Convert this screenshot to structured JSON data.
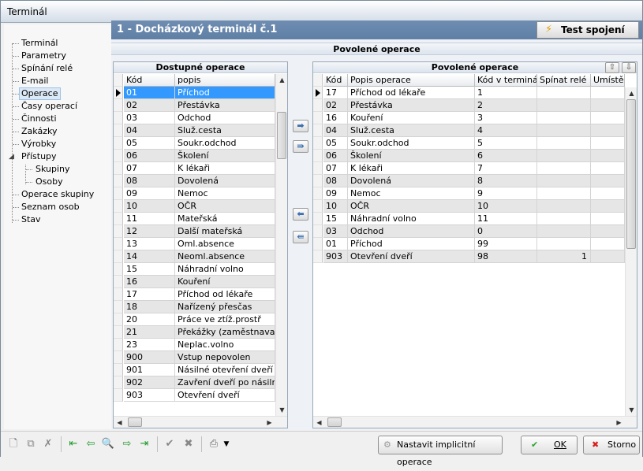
{
  "window": {
    "title": "Terminál"
  },
  "tree": {
    "items": [
      {
        "label": "Terminál",
        "level": 0
      },
      {
        "label": "Parametry",
        "level": 0
      },
      {
        "label": "Spínání relé",
        "level": 0
      },
      {
        "label": "E-mail",
        "level": 0
      },
      {
        "label": "Operace",
        "level": 0,
        "selected": true
      },
      {
        "label": "Časy operací",
        "level": 0
      },
      {
        "label": "Činnosti",
        "level": 0
      },
      {
        "label": "Zakázky",
        "level": 0
      },
      {
        "label": "Výrobky",
        "level": 0
      },
      {
        "label": "Přístupy",
        "level": 0,
        "expanded": true
      },
      {
        "label": "Skupiny",
        "level": 1
      },
      {
        "label": "Osoby",
        "level": 1
      },
      {
        "label": "Operace skupiny",
        "level": 0
      },
      {
        "label": "Seznam osob",
        "level": 0
      },
      {
        "label": "Stav",
        "level": 0
      }
    ]
  },
  "header": {
    "title": "1  -  Docházkový terminál č.1",
    "test_button": "Test spojení",
    "section_title": "Povolené operace"
  },
  "available": {
    "caption": "Dostupné operace",
    "columns": [
      "Kód",
      "popis"
    ],
    "rows": [
      [
        "01",
        "Příchod"
      ],
      [
        "02",
        "Přestávka"
      ],
      [
        "03",
        "Odchod"
      ],
      [
        "04",
        "Služ.cesta"
      ],
      [
        "05",
        "Soukr.odchod"
      ],
      [
        "06",
        "Školení"
      ],
      [
        "07",
        "K lékaři"
      ],
      [
        "08",
        "Dovolená"
      ],
      [
        "09",
        "Nemoc"
      ],
      [
        "10",
        "OČR"
      ],
      [
        "11",
        "Mateřská"
      ],
      [
        "12",
        "Další mateřská"
      ],
      [
        "13",
        "Oml.absence"
      ],
      [
        "14",
        "Neoml.absence"
      ],
      [
        "15",
        "Náhradní volno"
      ],
      [
        "16",
        "Kouření"
      ],
      [
        "17",
        "Příchod od lékaře"
      ],
      [
        "18",
        "Nařízený přesčas"
      ],
      [
        "20",
        "Práce ve ztíž.prostř"
      ],
      [
        "21",
        "Překážky (zaměstnavatel)"
      ],
      [
        "23",
        "Neplac.volno"
      ],
      [
        "900",
        "Vstup nepovolen"
      ],
      [
        "901",
        "Násilné otevření dveří"
      ],
      [
        "902",
        "Zavření dveří po násilném"
      ],
      [
        "903",
        "Otevření dveří"
      ]
    ],
    "selected_row": 0
  },
  "allowed": {
    "caption": "Povolené operace",
    "columns": [
      "Kód",
      "Popis operace",
      "Kód v terminálu",
      "Spínat relé",
      "Umístění"
    ],
    "rows": [
      [
        "17",
        "Příchod od lékaře",
        "1",
        "",
        ""
      ],
      [
        "02",
        "Přestávka",
        "2",
        "",
        ""
      ],
      [
        "16",
        "Kouření",
        "3",
        "",
        ""
      ],
      [
        "04",
        "Služ.cesta",
        "4",
        "",
        ""
      ],
      [
        "05",
        "Soukr.odchod",
        "5",
        "",
        ""
      ],
      [
        "06",
        "Školení",
        "6",
        "",
        ""
      ],
      [
        "07",
        "K lékaři",
        "7",
        "",
        ""
      ],
      [
        "08",
        "Dovolená",
        "8",
        "",
        ""
      ],
      [
        "09",
        "Nemoc",
        "9",
        "",
        ""
      ],
      [
        "10",
        "OČR",
        "10",
        "",
        ""
      ],
      [
        "15",
        "Náhradní volno",
        "11",
        "",
        ""
      ],
      [
        "03",
        "Odchod",
        "0",
        "",
        ""
      ],
      [
        "01",
        "Příchod",
        "99",
        "",
        ""
      ],
      [
        "903",
        "Otevření dveří",
        "98",
        "1",
        ""
      ]
    ]
  },
  "buttons": {
    "set_default": "Nastavit implicitní operace",
    "ok": "OK",
    "cancel": "Storno"
  },
  "colors": {
    "header": "#6683a8",
    "selection": "#3399ff"
  }
}
